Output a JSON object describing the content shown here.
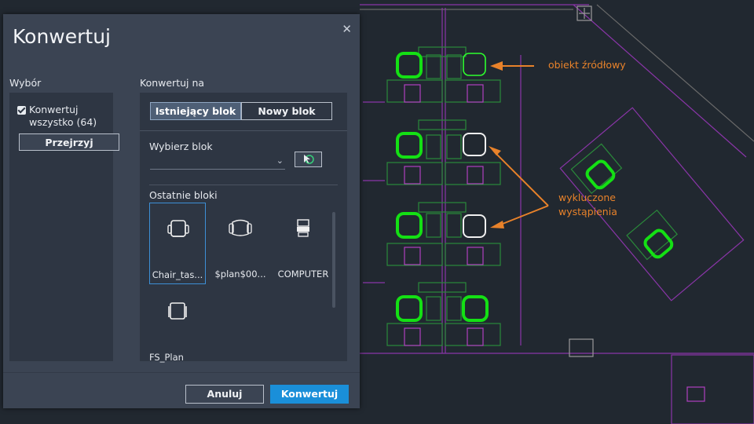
{
  "dialog": {
    "title": "Konwertuj",
    "close_icon": "close-icon",
    "selection": {
      "label": "Wybór",
      "checkbox_label": "Konwertuj wszystko (64)",
      "checkbox_checked": true,
      "preview_button": "Przejrzyj"
    },
    "convert_to": {
      "label": "Konwertuj na",
      "tabs": [
        {
          "label": "Istniejący blok",
          "active": true
        },
        {
          "label": "Nowy blok",
          "active": false
        }
      ],
      "select_block_label": "Wybierz blok",
      "select_value": "",
      "recent_blocks_label": "Ostatnie bloki",
      "recent_blocks": [
        {
          "label": "Chair_tas...",
          "icon": "task-chair-icon",
          "selected": true
        },
        {
          "label": "$plan$00...",
          "icon": "armchair-icon",
          "selected": false
        },
        {
          "label": "COMPUTER",
          "icon": "computer-icon",
          "selected": false
        },
        {
          "label": "FS_Plan",
          "icon": "chair-plan-icon",
          "selected": false
        }
      ]
    },
    "footer": {
      "cancel_label": "Anuluj",
      "convert_label": "Konwertuj"
    }
  },
  "annotations": {
    "source_object": "obiekt źródłowy",
    "excluded_instances": "wykluczone wystąpienia"
  },
  "colors": {
    "accent": "#1a8fd9",
    "annotation": "#e8822a",
    "highlight_green": "#14e014",
    "cad_magenta": "#8a35a8",
    "cad_green": "#2a8a3a"
  }
}
